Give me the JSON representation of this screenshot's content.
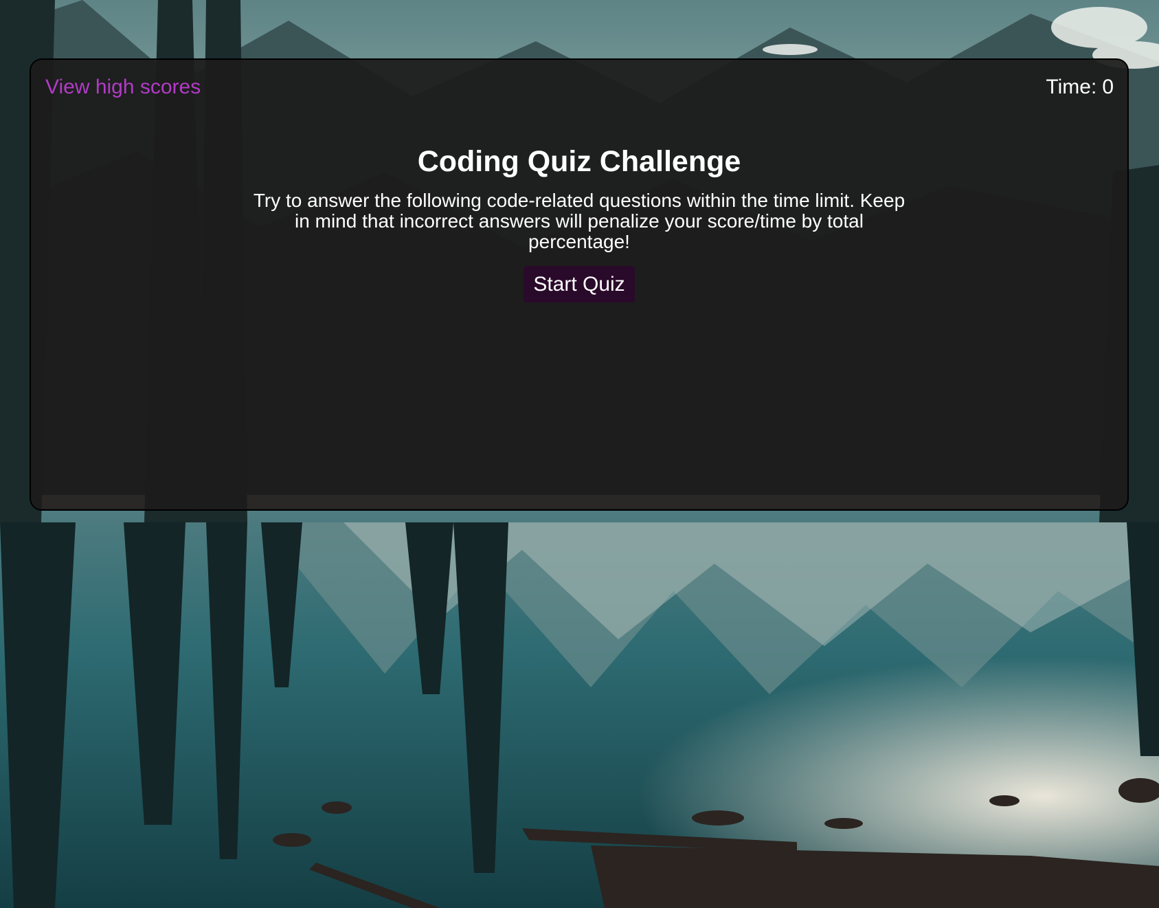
{
  "header": {
    "highscores_link": "View high scores",
    "timer_label": "Time:",
    "timer_value": "0"
  },
  "intro": {
    "title": "Coding Quiz Challenge",
    "description": "Try to answer the following code-related questions within the time limit. Keep in mind that incorrect answers will penalize your score/time by total percentage!",
    "start_button": "Start Quiz"
  },
  "colors": {
    "link": "#b23bc7",
    "button_bg": "#2a0a2a",
    "card_bg": "#1c1b1b"
  }
}
